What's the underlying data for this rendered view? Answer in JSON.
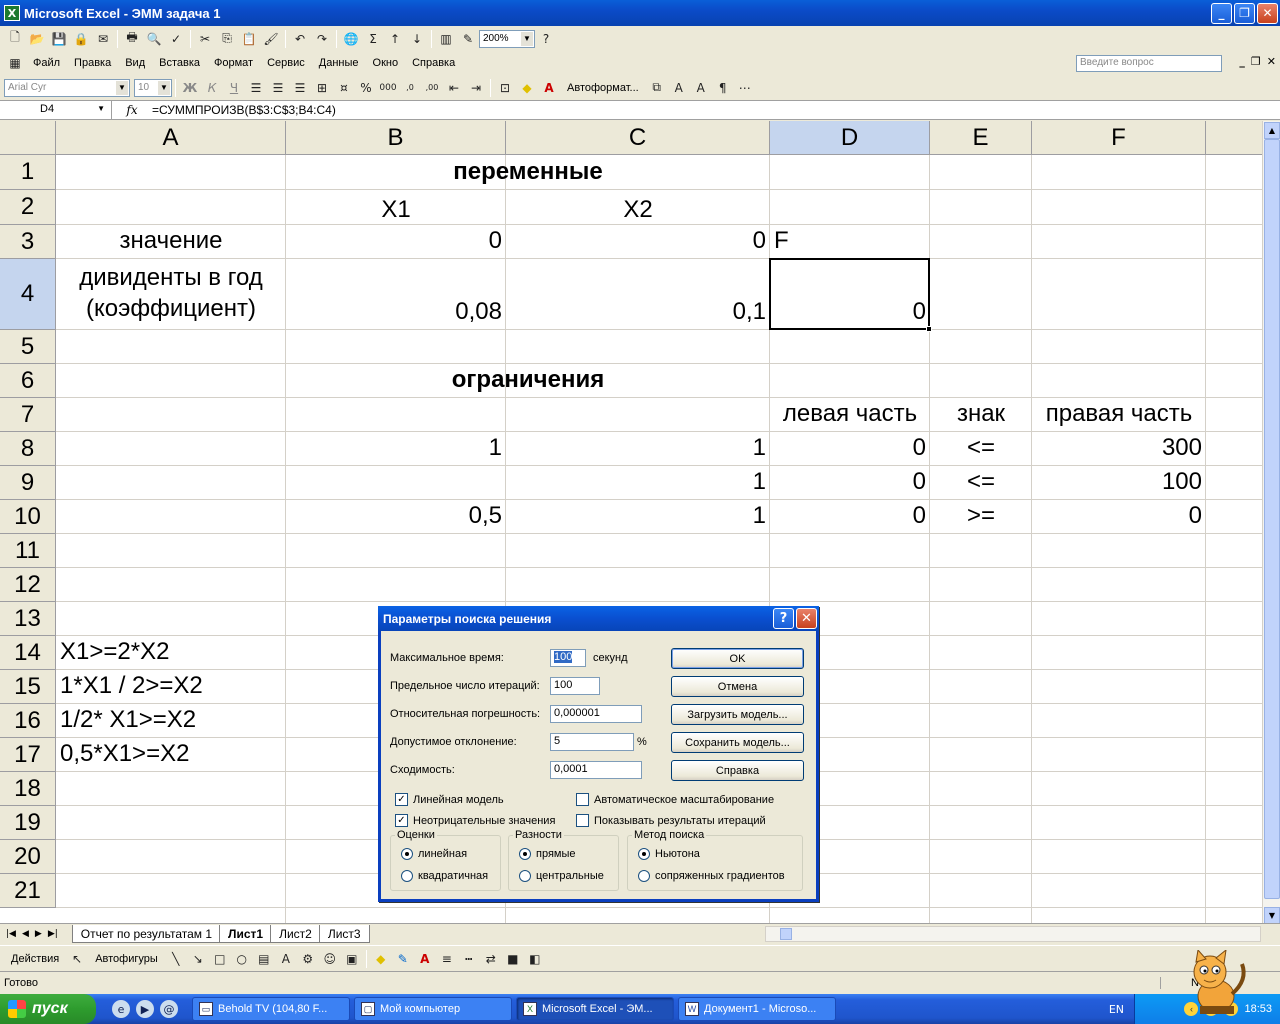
{
  "window": {
    "title": "Microsoft Excel - ЭММ задача 1",
    "app_icon": "excel-icon"
  },
  "toolbar": {
    "zoom": "200%"
  },
  "menu": [
    "Файл",
    "Правка",
    "Вид",
    "Вставка",
    "Формат",
    "Сервис",
    "Данные",
    "Окно",
    "Справка"
  ],
  "help_placeholder": "Введите вопрос",
  "format_toolbar": {
    "font": "Arial Cyr",
    "size": "10",
    "autoformat": "Автоформат..."
  },
  "formula_bar": {
    "cell_ref": "D4",
    "fx": "fx",
    "formula": "=СУММПРОИЗВ(B$3:C$3;B4:C4)"
  },
  "columns": [
    "A",
    "B",
    "C",
    "D",
    "E",
    "F"
  ],
  "rows": [
    "1",
    "2",
    "3",
    "4",
    "5",
    "6",
    "7",
    "8",
    "9",
    "10",
    "11",
    "12",
    "13",
    "14",
    "15",
    "16",
    "17",
    "18",
    "19",
    "20",
    "21"
  ],
  "cells": {
    "B1": "переменные",
    "B2": "X1",
    "C2": "X2",
    "A3": "значение",
    "B3": "0",
    "C3": "0",
    "D3": "F",
    "A4_line1": "дивиденты в год",
    "A4_line2": "(коэффициент)",
    "B4": "0,08",
    "C4": "0,1",
    "D4": "0",
    "B6": "ограничения",
    "D7": "левая часть",
    "E7": "знак",
    "F7": "правая часть",
    "B8": "1",
    "C8": "1",
    "D8": "0",
    "E8": "<=",
    "F8": "300",
    "C9": "1",
    "D9": "0",
    "E9": "<=",
    "F9": "100",
    "B10": "0,5",
    "C10": "1",
    "D10": "0",
    "E10": ">=",
    "F10": "0",
    "A14": "X1>=2*X2",
    "A15": "1*X1 / 2>=X2",
    "A16": "1/2* X1>=X2",
    "A17": "0,5*X1>=X2"
  },
  "sheets": [
    "Отчет по результатам 1",
    "Лист1",
    "Лист2",
    "Лист3"
  ],
  "drawing_toolbar": {
    "actions": "Действия",
    "autoshapes": "Автофигуры"
  },
  "status": {
    "text": "Готово",
    "num": "NUM"
  },
  "dialog": {
    "title": "Параметры поиска решения",
    "max_time_label": "Максимальное время:",
    "max_time": "100",
    "seconds": "секунд",
    "iterations_label": "Предельное число итераций:",
    "iterations": "100",
    "precision_label": "Относительная погрешность:",
    "precision": "0,000001",
    "tolerance_label": "Допустимое отклонение:",
    "tolerance": "5",
    "percent": "%",
    "convergence_label": "Сходимость:",
    "convergence": "0,0001",
    "ok": "OK",
    "cancel": "Отмена",
    "load_model": "Загрузить модель...",
    "save_model": "Сохранить модель...",
    "help": "Справка",
    "linear_model": "Линейная модель",
    "auto_scaling": "Автоматическое масштабирование",
    "non_negative": "Неотрицательные значения",
    "show_iterations": "Показывать результаты итераций",
    "estimates_title": "Оценки",
    "estimates_linear": "линейная",
    "estimates_quadratic": "квадратичная",
    "derivatives_title": "Разности",
    "derivatives_forward": "прямые",
    "derivatives_central": "центральные",
    "search_title": "Метод поиска",
    "search_newton": "Ньютона",
    "search_conjugate": "сопряженных градиентов"
  },
  "taskbar": {
    "start": "пуск",
    "tasks": [
      "Behold TV (104,80 F...",
      "Мой компьютер",
      "Microsoft Excel - ЭМ...",
      "Документ1 - Microso..."
    ],
    "lang": "EN",
    "time": "18:53"
  }
}
